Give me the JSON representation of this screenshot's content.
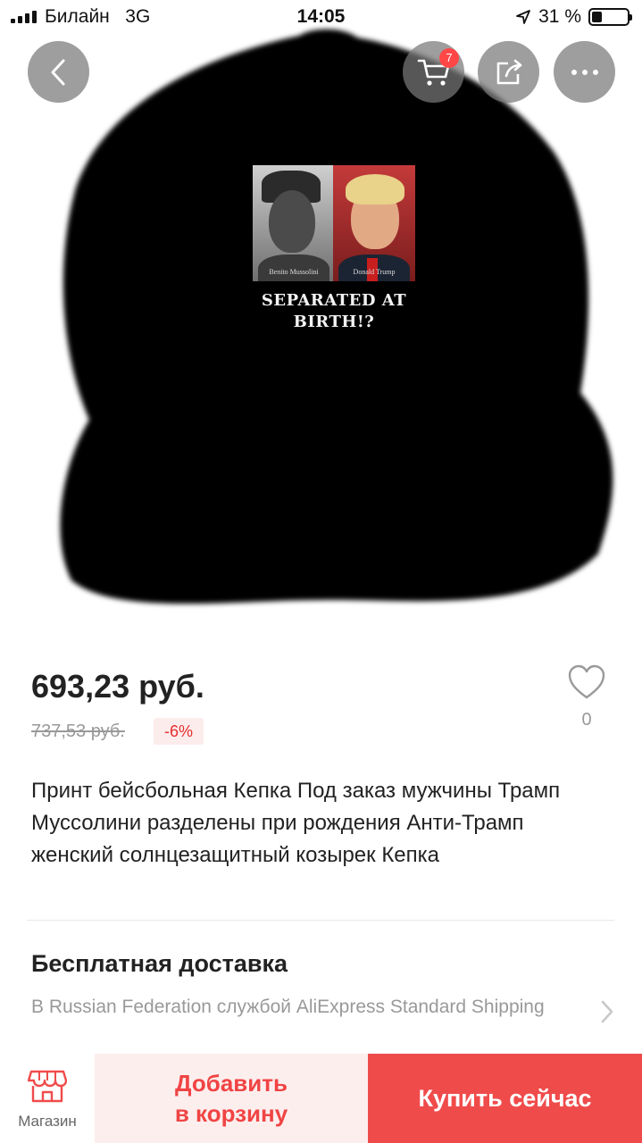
{
  "status_bar": {
    "carrier": "Билайн",
    "network": "3G",
    "time": "14:05",
    "battery": "31 %"
  },
  "header": {
    "cart_badge": "7",
    "icons": [
      "chevron-left-icon",
      "cart-icon",
      "share-icon",
      "more-icon"
    ]
  },
  "product_image": {
    "print_text": "SEPARATED AT BIRTH!?",
    "left_caption": "Benito Mussolini",
    "right_caption": "Donald Trump"
  },
  "price": {
    "current": "693,23 руб.",
    "original": "737,53 руб.",
    "discount": "-6%"
  },
  "wishlist": {
    "count": "0"
  },
  "product": {
    "title": "Принт бейсбольная Кепка Под заказ мужчины Трамп Муссолини разделены при рождения Анти-Трамп женский солнцезащитный козырек Кепка"
  },
  "shipping": {
    "title": "Бесплатная доставка",
    "description": "В Russian Federation службой AliExpress Standard Shipping"
  },
  "bottom_bar": {
    "shop_label": "Магазин",
    "add_to_cart_line1": "Добавить",
    "add_to_cart_line2": "в корзину",
    "buy_now": "Купить сейчас"
  },
  "colors": {
    "accent": "#f04b4b",
    "badge": "#ff4747",
    "discount_bg": "#fdecec",
    "muted_text": "#999999"
  }
}
